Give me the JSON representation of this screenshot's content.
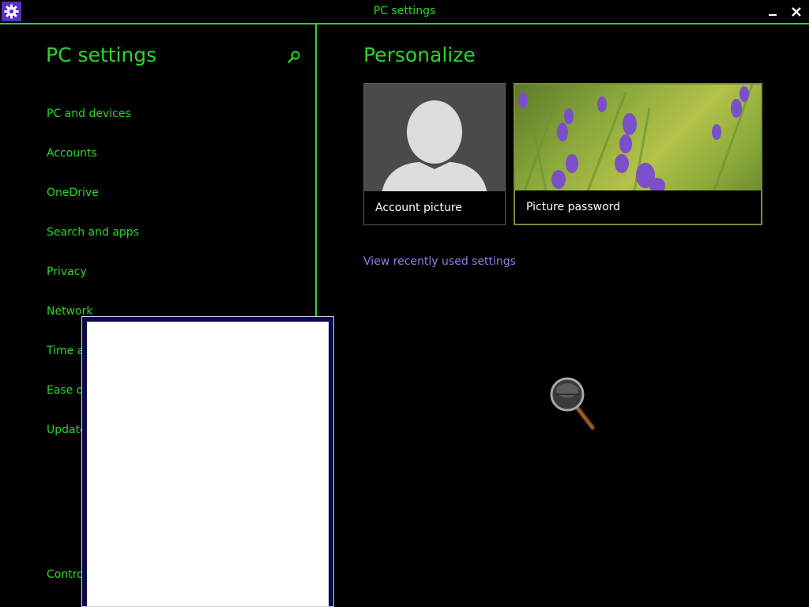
{
  "window": {
    "title": "PC settings",
    "app_icon": "gear-icon",
    "minimize_icon": "minimize-icon",
    "close_icon": "close-icon"
  },
  "sidebar": {
    "title": "PC settings",
    "search_icon": "search-icon",
    "items": [
      {
        "label": "PC and devices"
      },
      {
        "label": "Accounts"
      },
      {
        "label": "OneDrive"
      },
      {
        "label": "Search and apps"
      },
      {
        "label": "Privacy"
      },
      {
        "label": "Network"
      },
      {
        "label": "Time a"
      },
      {
        "label": "Ease of"
      },
      {
        "label": "Update"
      }
    ],
    "footer_link": "Contro"
  },
  "main": {
    "title": "Personalize",
    "tiles": [
      {
        "label": "Account picture"
      },
      {
        "label": "Picture password"
      }
    ],
    "recent_link": "View recently used settings"
  },
  "colors": {
    "accent": "#2bd62b",
    "background": "#000000",
    "link": "#8b7fe8",
    "app_icon_bg": "#5a2ec1"
  }
}
